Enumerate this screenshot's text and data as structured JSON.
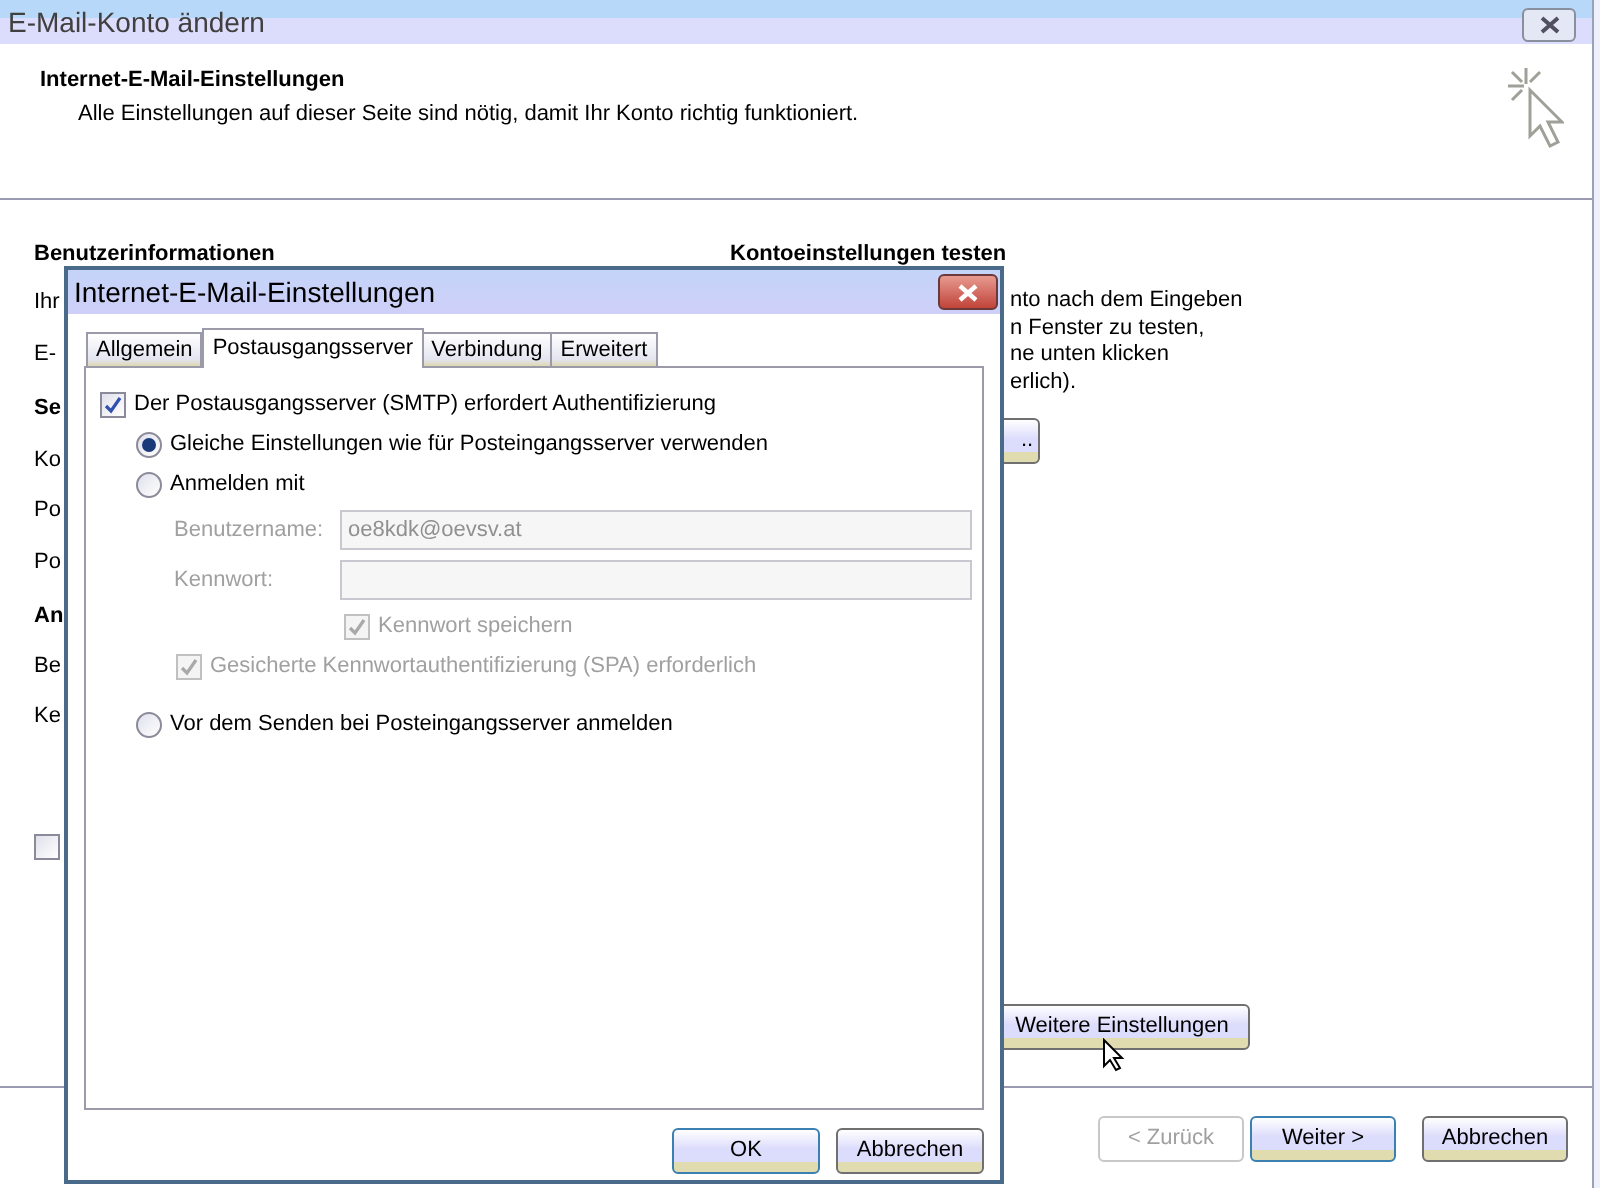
{
  "window": {
    "title": "E-Mail-Konto ändern"
  },
  "header": {
    "title": "Internet-E-Mail-Einstellungen",
    "subtitle": "Alle Einstellungen auf dieser Seite sind nötig, damit Ihr Konto richtig funktioniert."
  },
  "user_section": {
    "heading": "Benutzerinformationen",
    "fragments": [
      {
        "text": "Ihr",
        "kind": "label"
      },
      {
        "text": "E-",
        "kind": "label"
      },
      {
        "text": "Se",
        "kind": "heading"
      },
      {
        "text": "Ko",
        "kind": "label"
      },
      {
        "text": "Po",
        "kind": "label"
      },
      {
        "text": "Po",
        "kind": "label"
      },
      {
        "text": "An",
        "kind": "heading"
      },
      {
        "text": "Be",
        "kind": "label"
      },
      {
        "text": "Ke",
        "kind": "label"
      }
    ],
    "checkbox": {
      "checked": false
    }
  },
  "test_section": {
    "heading": "Kontoeinstellungen testen",
    "lines": [
      "nto nach dem Eingeben",
      "n Fenster zu testen,",
      "ne unten klicken",
      "erlich)."
    ],
    "button": ".."
  },
  "more_settings_button": "Weitere Einstellungen",
  "footer_buttons": [
    {
      "label": "< Zurück",
      "disabled": true,
      "primary": false
    },
    {
      "label": "Weiter >",
      "disabled": false,
      "primary": true
    },
    {
      "label": "Abbrechen",
      "disabled": false,
      "primary": false
    }
  ],
  "dialog": {
    "title": "Internet-E-Mail-Einstellungen",
    "tabs": [
      {
        "label": "Allgemein",
        "selected": false
      },
      {
        "label": "Postausgangsserver",
        "selected": true
      },
      {
        "label": "Verbindung",
        "selected": false
      },
      {
        "label": "Erweitert",
        "selected": false
      }
    ],
    "auth_checkbox": {
      "label": "Der Postausgangsserver (SMTP) erfordert Authentifizierung",
      "checked": true
    },
    "radios": [
      {
        "label": "Gleiche Einstellungen wie für Posteingangsserver verwenden",
        "selected": true
      },
      {
        "label": "Anmelden mit",
        "selected": false
      },
      {
        "label": "Vor dem Senden bei Posteingangsserver anmelden",
        "selected": false
      }
    ],
    "username": {
      "label": "Benutzername:",
      "value": "oe8kdk@oevsv.at",
      "disabled": true
    },
    "password": {
      "label": "Kennwort:",
      "disabled": true
    },
    "save_password": {
      "label": "Kennwort speichern",
      "checked": true,
      "disabled": true
    },
    "spa": {
      "label": "Gesicherte Kennwortauthentifizierung (SPA) erforderlich",
      "checked": true,
      "disabled": true
    },
    "buttons": [
      {
        "label": "OK",
        "primary": true
      },
      {
        "label": "Abbrechen",
        "primary": false
      }
    ]
  }
}
